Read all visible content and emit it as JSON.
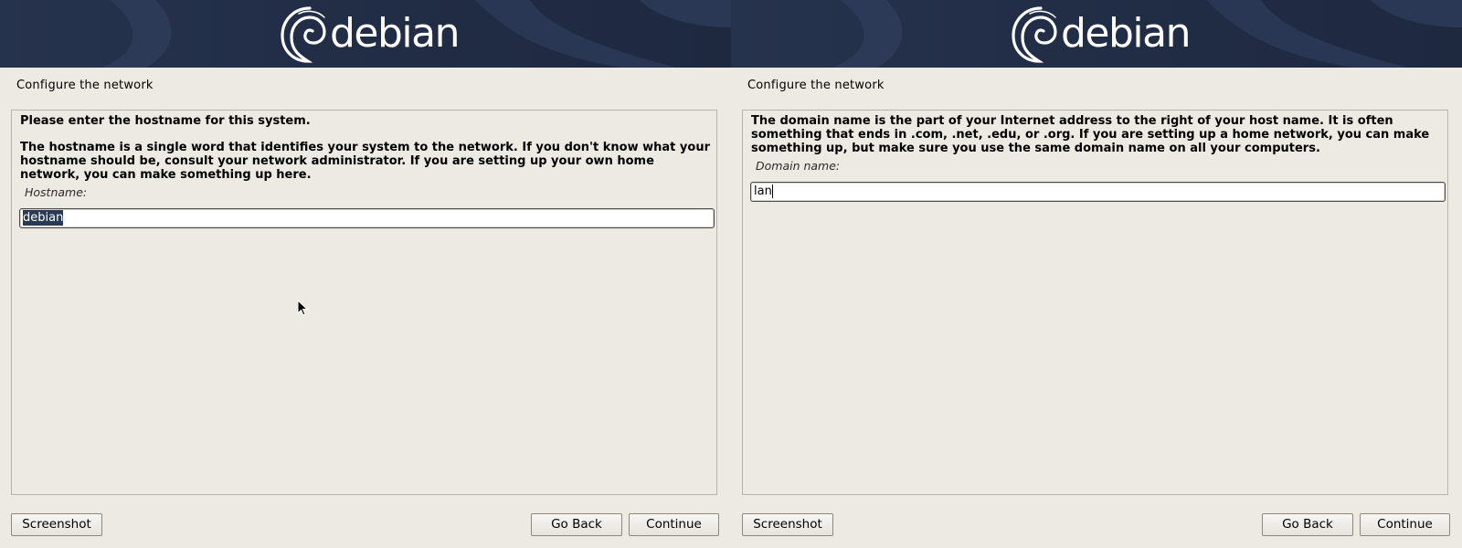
{
  "logo": {
    "wordmark": "debian"
  },
  "colors": {
    "banner": "#222e47",
    "background": "#edeae4",
    "selection": "#2b3a54"
  },
  "panels": [
    {
      "title": "Configure the network",
      "question_bold": "Please enter the hostname for this system.",
      "description": "The hostname is a single word that identifies your system to the network. If you don't know what your hostname should be, consult your network administrator. If you are setting up your own home network, you can make something up here.",
      "field_label": "Hostname:",
      "field_value": "debian",
      "field_selected": true,
      "buttons": {
        "screenshot": "Screenshot",
        "go_back": "Go Back",
        "continue": "Continue"
      }
    },
    {
      "title": "Configure the network",
      "description": "The domain name is the part of your Internet address to the right of your host name.  It is often something that ends in .com, .net, .edu, or .org.  If you are setting up a home network, you can make something up, but make sure you use the same domain name on all your computers.",
      "field_label": "Domain name:",
      "field_value": "lan",
      "field_selected": false,
      "buttons": {
        "screenshot": "Screenshot",
        "go_back": "Go Back",
        "continue": "Continue"
      }
    }
  ]
}
